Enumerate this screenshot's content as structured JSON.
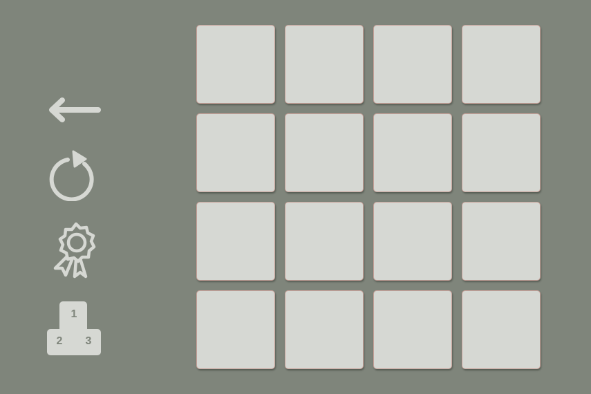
{
  "theme": {
    "background": "#7f857b",
    "tile_fill": "#d6d8d3",
    "tile_border": "#c9a29a",
    "icon_color": "#d6d8d3"
  },
  "sidebar": {
    "buttons": [
      {
        "id": "back",
        "icon": "arrow-left-icon"
      },
      {
        "id": "restart",
        "icon": "restart-icon"
      },
      {
        "id": "achievements",
        "icon": "award-ribbon-icon"
      },
      {
        "id": "leaderboard",
        "icon": "podium-icon"
      }
    ],
    "podium": {
      "first": "1",
      "second": "2",
      "third": "3"
    }
  },
  "board": {
    "rows": 4,
    "cols": 4,
    "tiles": [
      [
        "",
        "",
        "",
        ""
      ],
      [
        "",
        "",
        "",
        ""
      ],
      [
        "",
        "",
        "",
        ""
      ],
      [
        "",
        "",
        "",
        ""
      ]
    ]
  }
}
